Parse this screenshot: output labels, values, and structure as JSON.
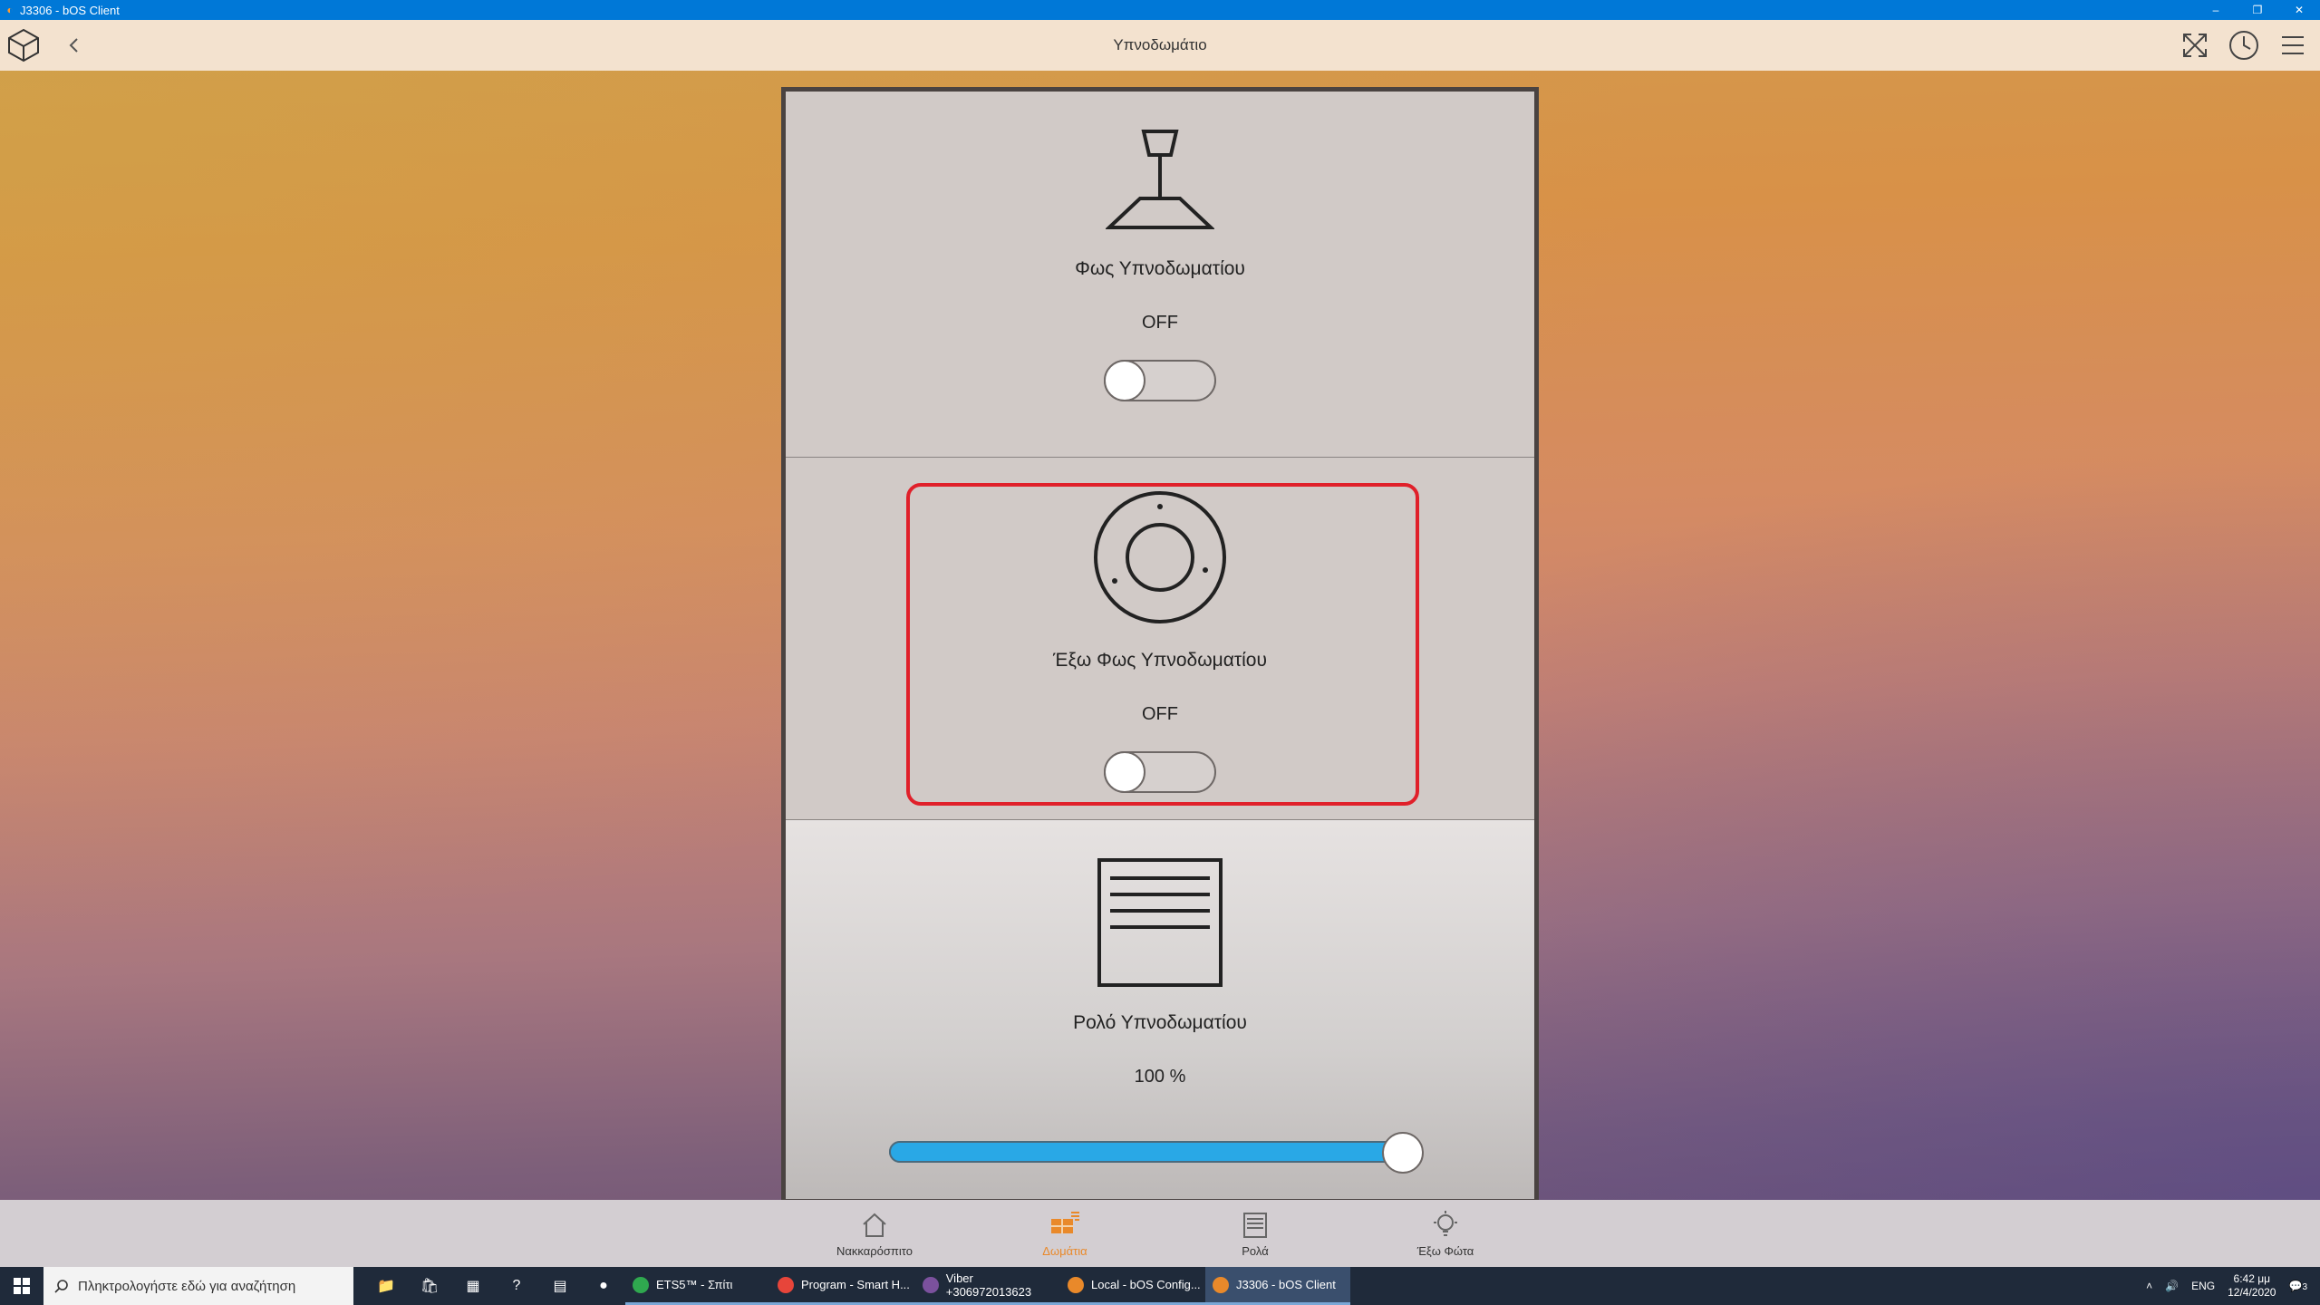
{
  "window": {
    "title": "J3306 - bOS Client",
    "minimize": "–",
    "restore": "❐",
    "close": "✕"
  },
  "header": {
    "title": "Υπνοδωμάτιο"
  },
  "cards": [
    {
      "label": "Φως Υπνοδωματίου",
      "status": "OFF",
      "on": false
    },
    {
      "label": "Έξω Φως Υπνοδωματίου",
      "status": "OFF",
      "on": false
    },
    {
      "label": "Ρολό Υπνοδωματίου",
      "status": "100 %",
      "level_percent": 100
    }
  ],
  "bottom_nav": [
    {
      "label": "Νακκαρόσπιτο",
      "icon": "home-icon"
    },
    {
      "label": "Δωμάτια",
      "icon": "rooms-icon",
      "active": true
    },
    {
      "label": "Ρολά",
      "icon": "shutter-icon"
    },
    {
      "label": "Έξω Φώτα",
      "icon": "outdoor-light-icon"
    }
  ],
  "taskbar": {
    "search_placeholder": "Πληκτρολογήστε εδώ για αναζήτηση",
    "apps": [
      {
        "label": "ETS5™ - Σπίτι",
        "color": "#2fa84f"
      },
      {
        "label": "Program - Smart H...",
        "color": "#e7453a"
      },
      {
        "label": "Viber +306972013623",
        "color": "#7b519d"
      },
      {
        "label": "Local - bOS Config...",
        "color": "#e9892a"
      },
      {
        "label": "J3306 - bOS Client",
        "color": "#e9892a",
        "active": true
      }
    ],
    "tray_lang": "ENG",
    "time": "6:42 μμ",
    "date": "12/4/2020",
    "notifications": "3"
  },
  "colors": {
    "accent": "#e9892a",
    "highlight": "#e0202a",
    "slider_fill": "#29a8e6"
  }
}
